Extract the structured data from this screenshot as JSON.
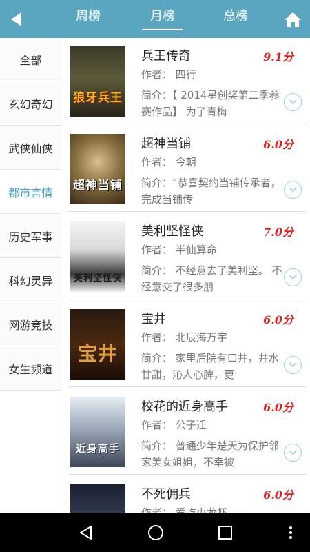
{
  "header": {
    "tabs": [
      {
        "label": "周榜"
      },
      {
        "label": "月榜"
      },
      {
        "label": "总榜"
      }
    ],
    "active_tab": "月榜",
    "bg_color": "#5aa5c0"
  },
  "sidebar": {
    "items": [
      {
        "label": "全部"
      },
      {
        "label": "玄幻奇幻"
      },
      {
        "label": "武侠仙侠"
      },
      {
        "label": "都市言情"
      },
      {
        "label": "历史军事"
      },
      {
        "label": "科幻灵异"
      },
      {
        "label": "网游竞技"
      },
      {
        "label": "女生频道"
      }
    ],
    "active_item": "都市言情",
    "active_color": "#3aa0c4"
  },
  "books": [
    {
      "title": "兵王传奇",
      "score": "9.1分",
      "author": "作者：  四行",
      "intro": "简介：【 2014星创奖第二季参赛作品】  为了青梅",
      "cover_text": "狼牙兵王"
    },
    {
      "title": "超神当铺",
      "score": "6.0分",
      "author": "作者：  今朝",
      "intro": "简介：“恭喜契约当铺传承者，完成当铺传",
      "cover_text": "超神当铺"
    },
    {
      "title": "美利坚怪侠",
      "score": "7.0分",
      "author": "作者：  半仙算命",
      "intro": "简介：  不经意去了美利坚。  不经意交了很多朋",
      "cover_text": "美利坚怪侠"
    },
    {
      "title": "宝井",
      "score": "6.0分",
      "author": "作者：  北辰海万宇",
      "intro": "简介：  家里后院有口井，井水甘甜，沁人心脾，更",
      "cover_text": "宝井"
    },
    {
      "title": "校花的近身高手",
      "score": "6.0分",
      "author": "作者：  公子迁",
      "intro": "简介：  普通少年楚天为保护邻家美女姐姐，不幸被",
      "cover_text": "近身高手"
    },
    {
      "title": "不死佣兵",
      "score": "6.0分",
      "author": "作者：  爱吃小龙虾",
      "intro": "",
      "cover_text": ""
    }
  ],
  "colors": {
    "score": "#e62020",
    "divider": "#e0e0e0",
    "expand_ring": "#9fd3e3"
  },
  "icons": {
    "back": "back-arrow-icon",
    "home": "home-icon",
    "expand": "chevron-down-icon",
    "nav_back": "nav-back-icon",
    "nav_home": "nav-home-icon",
    "nav_recents": "nav-recents-icon",
    "nav_menu": "nav-menu-icon"
  }
}
